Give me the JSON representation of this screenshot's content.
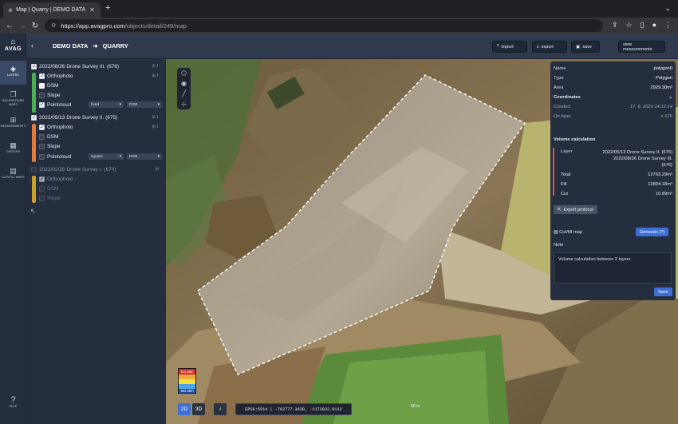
{
  "browser": {
    "tab_title": "Map | Quarry | DEMO DATA - A",
    "url_host": "https://app.avagpro.com",
    "url_path": "/objects/detail/249/map"
  },
  "app": {
    "logo": "AVAG",
    "nav": [
      {
        "label": "LAYERS",
        "icon": "layers-icon"
      },
      {
        "label": "BACKGROUND MAPS",
        "icon": "background-maps-icon"
      },
      {
        "label": "MEASUREMENTS",
        "icon": "measurements-icon"
      },
      {
        "label": "DESIGNS",
        "icon": "designs-icon"
      },
      {
        "label": "CUT/FILL MAPS",
        "icon": "cutfill-icon"
      }
    ],
    "help_label": "HELP",
    "breadcrumb": {
      "project": "DEMO DATA",
      "object": "QUARRY"
    },
    "toolbar": {
      "import": "import",
      "export": "export",
      "save": "save",
      "view_measurements": "view measurements"
    }
  },
  "layers": {
    "surveys": [
      {
        "name": "2022/08/26 Drone Survey III. (676)",
        "count": "1",
        "color": "#4caf50",
        "enabled": true,
        "items": [
          {
            "label": "Orthophoto",
            "checked": true,
            "count": "1"
          },
          {
            "label": "DSM",
            "checked": false
          },
          {
            "label": "Slope",
            "checked": false
          },
          {
            "label": "Pointcloud",
            "checked": true,
            "mode": "fixed",
            "color_mode": "RGB"
          }
        ]
      },
      {
        "name": "2022/05/13 Drone Survey II. (675)",
        "count": "1",
        "color": "#e07b39",
        "enabled": true,
        "items": [
          {
            "label": "Orthophoto",
            "checked": true,
            "count": "1"
          },
          {
            "label": "DSM",
            "checked": false
          },
          {
            "label": "Slope",
            "checked": false
          },
          {
            "label": "Pointcloud",
            "checked": false,
            "mode": "square",
            "color_mode": "RGB"
          }
        ]
      },
      {
        "name": "2022/02/25 Drone Survey I. (674)",
        "count": "",
        "color": "#c9a227",
        "enabled": false,
        "items": [
          {
            "label": "Orthophoto",
            "checked": true
          },
          {
            "label": "DSM",
            "checked": false
          },
          {
            "label": "Slope",
            "checked": false
          }
        ]
      }
    ]
  },
  "map": {
    "legend": {
      "max": "511.68m",
      "min": "483.36m"
    },
    "mode_2d": "2D",
    "mode_3d": "3D",
    "info": "i",
    "epsg": "EPSG:5514 | -762777.3630, -1172832.0112",
    "scale": "50 m"
  },
  "details": {
    "name_label": "Name",
    "name": "polygon0",
    "type_label": "Type",
    "type": "Polygon",
    "area_label": "Area",
    "area": "2929.30m²",
    "coordinates_label": "Coordinates",
    "created_label": "Created",
    "created": "17. 8. 2023 14:12:14",
    "on_layer_label": "On layer",
    "on_layer": "676",
    "volume_title": "Volume calculation",
    "layer_label": "Layer",
    "layer_value_1": "2022/05/13 Drone Survey II. (675)",
    "layer_value_2": "2022/08/26 Drone Survey III.",
    "layer_value_3": "(676)",
    "total_label": "Total",
    "total": "12793.29m³",
    "fill_label": "Fill",
    "fill": "12804.18m³",
    "cut_label": "Cut",
    "cut": "10.89m³",
    "export_protocol": "Export protocol",
    "cutfill_label": "Cut/fill map",
    "generate": "Generate (?)",
    "note_label": "Note",
    "note": "Volume calculation between 2 layers",
    "save": "Save"
  },
  "colors": {
    "accent": "#3d6fd6",
    "panel": "#252e3f",
    "fill": "#4caf50",
    "cut": "#d9534f"
  }
}
